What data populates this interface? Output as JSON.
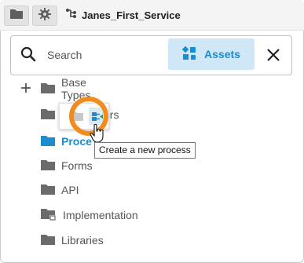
{
  "toolbar": {
    "folder_icon": "folder-icon",
    "settings_icon": "gear-icon",
    "service_icon": "service-branch-icon",
    "service_name": "Janes_First_Service"
  },
  "search": {
    "placeholder": "Search",
    "value": "",
    "assets_label": "Assets",
    "assets_icon": "assets-icon",
    "close_icon": "close-icon"
  },
  "tree": {
    "expand_icon": "plus-icon",
    "items": [
      {
        "label": "Base Types",
        "icon": "folder-icon"
      },
      {
        "label": "Decisions",
        "visible_label": "ors",
        "icon": "folder-icon"
      },
      {
        "label": "Processes",
        "visible_label": "Proce",
        "icon": "folder-icon",
        "selected": true
      },
      {
        "label": "Forms",
        "icon": "folder-icon"
      },
      {
        "label": "API",
        "icon": "folder-icon"
      },
      {
        "label": "Implementation",
        "icon": "folder-link-icon"
      },
      {
        "label": "Libraries",
        "icon": "folder-icon"
      }
    ]
  },
  "popup": {
    "new_process_icon": "new-process-icon",
    "tooltip": "Create a new process"
  },
  "colors": {
    "accent": "#1a8ccf",
    "assets_bg": "#cfe7f7",
    "highlight_ring": "#f28c1e",
    "folder": "#6b6b6b"
  }
}
